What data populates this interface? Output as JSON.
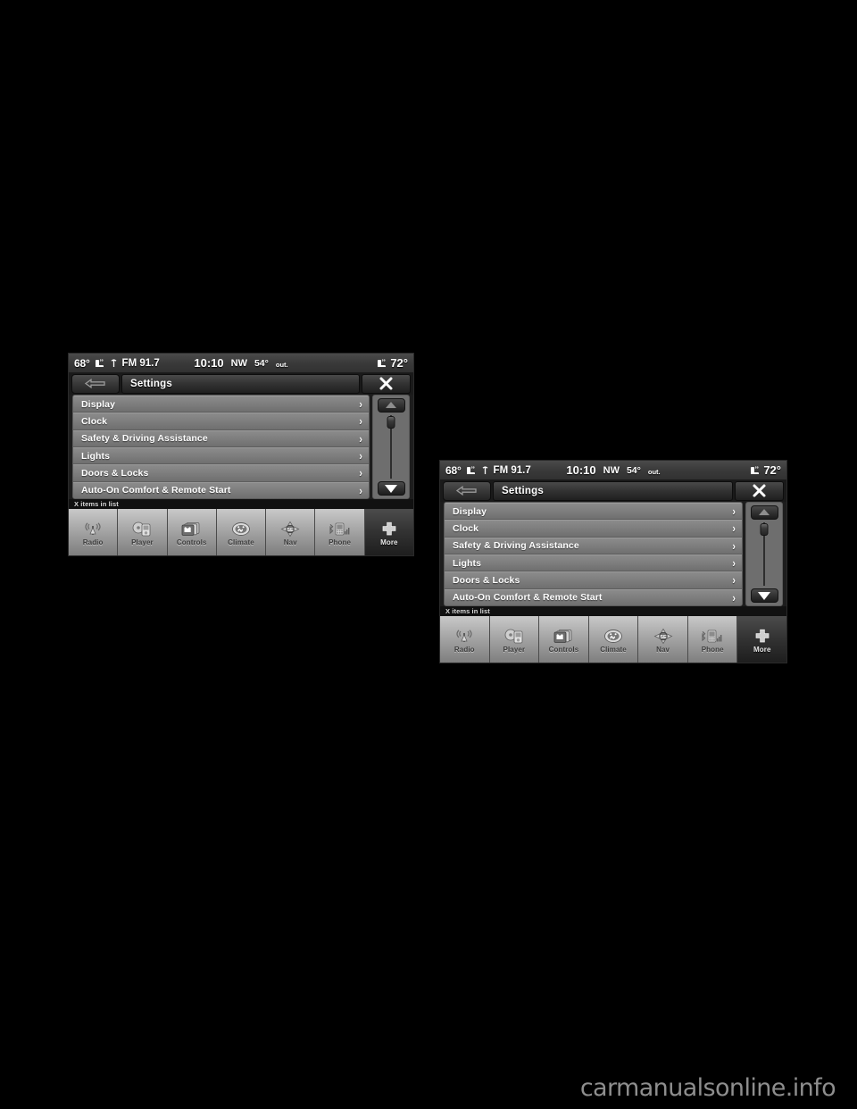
{
  "page": {
    "background_color": "#000000",
    "watermark": "carmanualsonline.info"
  },
  "screens": [
    {
      "id": "left-screen",
      "position": "upper-left"
    },
    {
      "id": "right-screen",
      "position": "middle-right"
    }
  ],
  "radio_screen": {
    "status_bar": {
      "left_seat_temp": "68°",
      "left_seat_icon": "heated-seat-icon",
      "antenna_icon": "radio-antenna-icon",
      "station": "FM 91.7",
      "clock": "10:10",
      "compass_direction": "NW",
      "outside_temp": "54°",
      "outside_label": "out.",
      "right_seat_icon": "heated-seat-icon",
      "right_seat_temp": "72°"
    },
    "title_bar": {
      "back_icon": "back-arrow-icon",
      "title": "Settings",
      "close_icon": "close-x-icon"
    },
    "list": {
      "chevron": "›",
      "items": [
        {
          "label": "Display"
        },
        {
          "label": "Clock"
        },
        {
          "label": "Safety & Driving Assistance"
        },
        {
          "label": "Lights"
        },
        {
          "label": "Doors & Locks"
        },
        {
          "label": "Auto-On Comfort & Remote Start"
        }
      ]
    },
    "scrollbar": {
      "up_icon": "scroll-up-triangle-icon",
      "down_icon": "scroll-down-triangle-icon",
      "thumb": "scrollbar-thumb"
    },
    "items_caption": "X items in list",
    "taskbar": {
      "items": [
        {
          "label": "Radio",
          "icon": "radio-tower-icon",
          "active": false
        },
        {
          "label": "Player",
          "icon": "media-player-icon",
          "active": false
        },
        {
          "label": "Controls",
          "icon": "controls-icon",
          "active": false
        },
        {
          "label": "Climate",
          "icon": "climate-fan-icon",
          "active": false
        },
        {
          "label": "Nav",
          "icon": "nav-compass-icon",
          "active": false
        },
        {
          "label": "Phone",
          "icon": "phone-icon",
          "active": false
        },
        {
          "label": "More",
          "icon": "more-plus-icon",
          "active": true
        }
      ]
    }
  }
}
